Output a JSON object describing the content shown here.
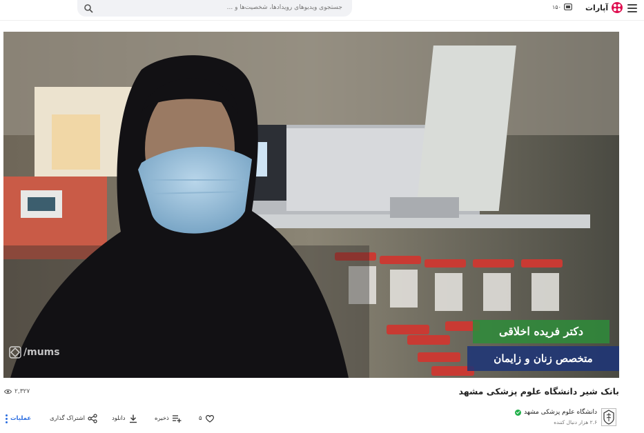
{
  "header": {
    "search_placeholder": "جستجوی ویدیوهای رویدادها، شخصیت‌ها و ...",
    "logo_text": "آپارات",
    "counter": "۱۵۰",
    "brand_color": "#df0f50"
  },
  "video": {
    "watermark": "/mums",
    "lower_third_name": "دکتر فریده اخلاقی",
    "lower_third_title": "متخصص زنان و زایمان"
  },
  "info": {
    "title": "بانک شیر دانشگاه علوم پزشکی مشهد",
    "views": "۲,۳۲۷"
  },
  "actions": {
    "operations": "عملیات",
    "share": "اشتراک گذاری",
    "download": "دانلود",
    "save": "ذخیره",
    "likes": "۵"
  },
  "channel": {
    "name": "دانشگاه علوم پزشکی مشهد",
    "followers": "۲.۶ هزار دنبال کننده",
    "verified_color": "#22b04b"
  }
}
